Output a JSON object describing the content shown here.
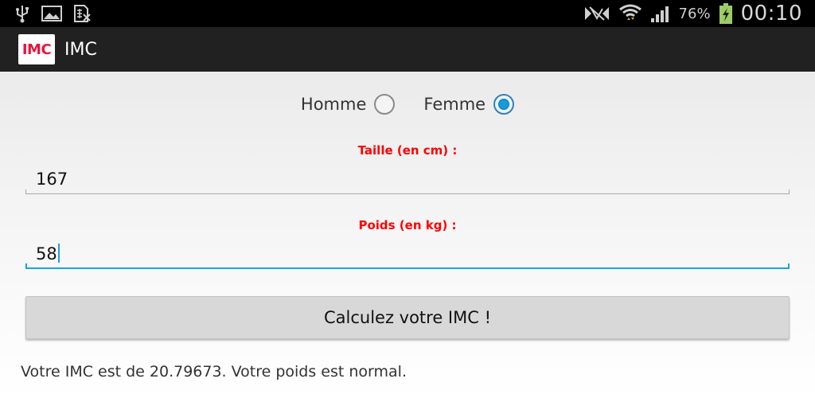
{
  "status_bar": {
    "battery_percent": "76%",
    "time": "00:10",
    "icons": [
      "usb-icon",
      "image-icon",
      "sim-icon",
      "nfc-icon",
      "wifi-icon",
      "signal-icon",
      "battery-charging-icon"
    ]
  },
  "app": {
    "title": "IMC",
    "logo_text": "IMC"
  },
  "form": {
    "gender": {
      "options": [
        {
          "label": "Homme",
          "checked": false
        },
        {
          "label": "Femme",
          "checked": true
        }
      ]
    },
    "height_label": "Taille (en cm) :",
    "height_value": "167",
    "weight_label": "Poids (en kg) :",
    "weight_value": "58",
    "submit_label": "Calculez votre IMC !"
  },
  "result_text": "Votre IMC est de 20.79673. Votre poids est normal.",
  "colors": {
    "label_red": "#ff0000",
    "focus_blue": "#1ea1dc",
    "action_bar": "#212121",
    "logo_red": "#e8153e"
  }
}
